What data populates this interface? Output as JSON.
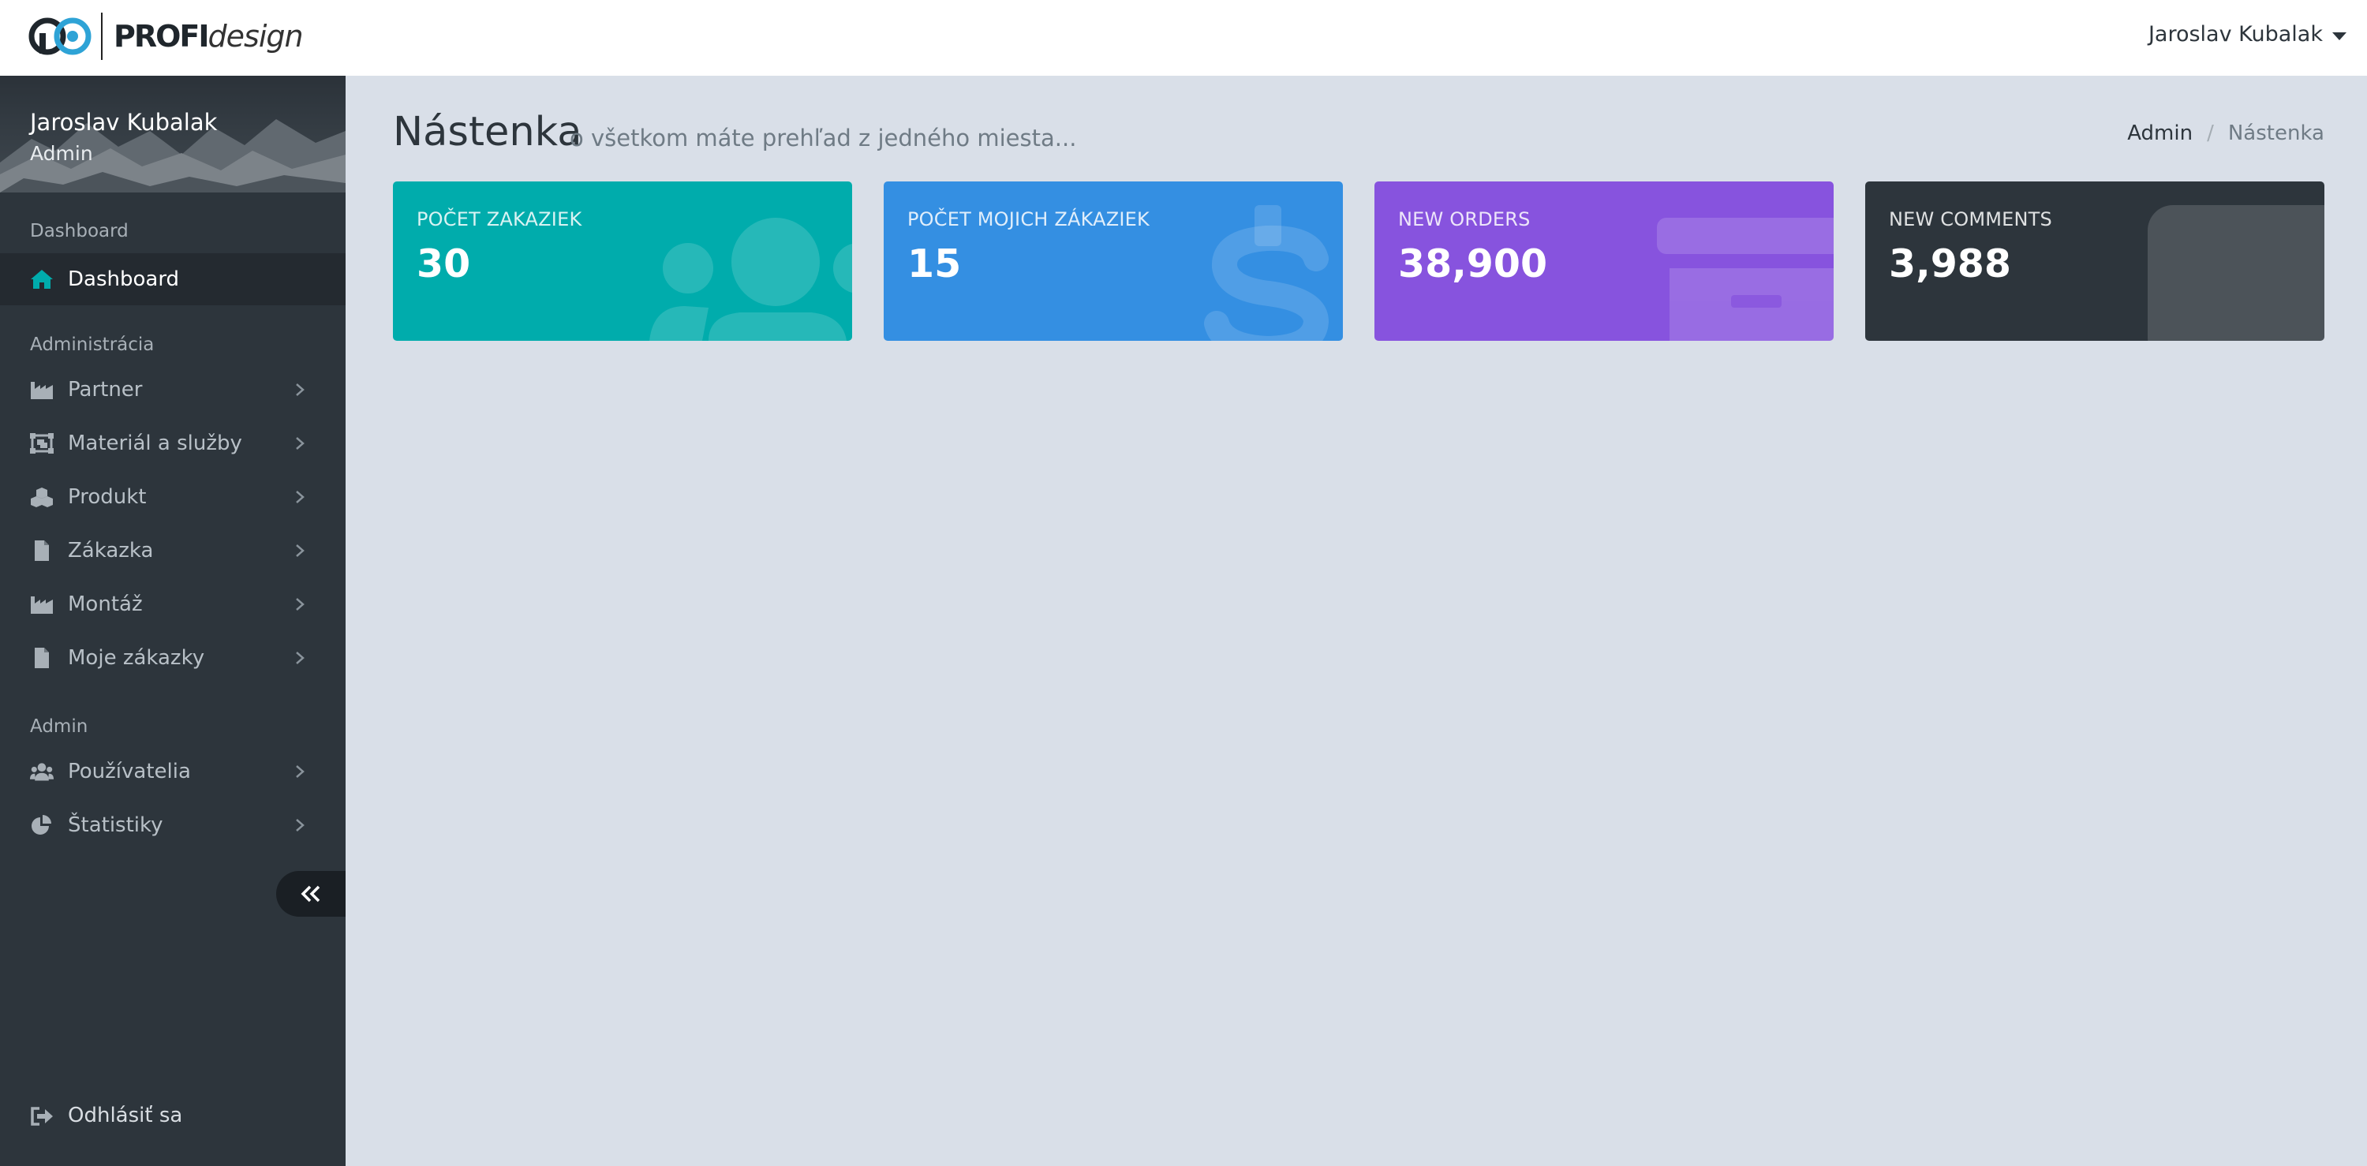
{
  "header": {
    "logo_bold": "PROFI",
    "logo_light": "design",
    "user_name": "Jaroslav Kubalak"
  },
  "sidebar": {
    "profile": {
      "name": "Jaroslav Kubalak",
      "role": "Admin"
    },
    "sections": {
      "dashboard": "Dashboard",
      "administracia": "Administrácia",
      "admin": "Admin"
    },
    "items": [
      {
        "label": "Dashboard",
        "icon": "home-icon",
        "active": true
      },
      {
        "label": "Partner",
        "icon": "industry-icon"
      },
      {
        "label": "Materiál a služby",
        "icon": "object-group-icon"
      },
      {
        "label": "Produkt",
        "icon": "cubes-icon"
      },
      {
        "label": "Zákazka",
        "icon": "file-icon"
      },
      {
        "label": "Montáž",
        "icon": "industry-icon"
      },
      {
        "label": "Moje zákazky",
        "icon": "file-icon"
      },
      {
        "label": "Používatelia",
        "icon": "users-icon"
      },
      {
        "label": "Štatistiky",
        "icon": "pie-chart-icon"
      }
    ],
    "logout_label": "Odhlásiť sa"
  },
  "main": {
    "title": "Nástenka",
    "subtitle": "o všetkom máte prehľad z jedného miesta...",
    "breadcrumb": {
      "parent": "Admin",
      "separator": "/",
      "current": "Nástenka"
    },
    "cards": [
      {
        "title": "POČET ZAKAZIEK",
        "value": "30",
        "color": "#00acac",
        "icon": "users-icon"
      },
      {
        "title": "POČET MOJICH ZÁKAZIEK",
        "value": "15",
        "color": "#348fe2",
        "icon": "dollar-icon"
      },
      {
        "title": "NEW ORDERS",
        "value": "38,900",
        "color": "#8753de",
        "icon": "archive-icon"
      },
      {
        "title": "NEW COMMENTS",
        "value": "3,988",
        "color": "#2d353c",
        "icon": "comment-icon"
      }
    ]
  },
  "colors": {
    "sidebar_bg": "#2d353c",
    "content_bg": "#d9dfe8",
    "accent": "#00acac"
  }
}
